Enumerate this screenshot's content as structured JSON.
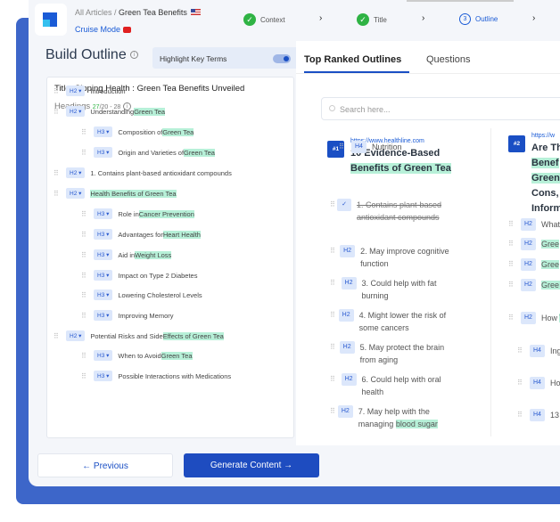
{
  "header": {
    "breadcrumb_root": "All Articles /",
    "breadcrumb_current": "Green Tea Benefits",
    "cruise_mode": "Cruise Mode",
    "steps": [
      {
        "label": "Context",
        "state": "done"
      },
      {
        "label": "Title",
        "state": "done"
      },
      {
        "label": "Outline",
        "state": "current",
        "number": "3"
      }
    ]
  },
  "left": {
    "title": "Build Outline",
    "highlight_label": "Highlight Key Terms",
    "highlight_on": true,
    "article_title": "Title: Sipping Health : Green Tea Benefits Unveiled",
    "headings_label": "Headings",
    "headings_count": "27",
    "headings_range": "/20 - 28",
    "headings": [
      {
        "level": "H2",
        "parts": [
          {
            "t": "Introduction"
          }
        ]
      },
      {
        "level": "H2",
        "parts": [
          {
            "t": "Understanding "
          },
          {
            "t": "Green Tea",
            "hl": true
          }
        ]
      },
      {
        "level": "H3",
        "parts": [
          {
            "t": "Composition of "
          },
          {
            "t": "Green Tea",
            "hl": true
          }
        ]
      },
      {
        "level": "H3",
        "parts": [
          {
            "t": "Origin and Varieties of "
          },
          {
            "t": "Green Tea",
            "hl": true
          }
        ]
      },
      {
        "level": "H2",
        "parts": [
          {
            "t": "1. Contains plant-based antioxidant compounds"
          }
        ]
      },
      {
        "level": "H2",
        "parts": [
          {
            "t": "Health Benefits of Green Tea",
            "hl": true
          }
        ]
      },
      {
        "level": "H3",
        "parts": [
          {
            "t": "Role in "
          },
          {
            "t": "Cancer Prevention",
            "hl": true
          }
        ]
      },
      {
        "level": "H3",
        "parts": [
          {
            "t": "Advantages for "
          },
          {
            "t": "Heart Health",
            "hl": true
          }
        ]
      },
      {
        "level": "H3",
        "parts": [
          {
            "t": "Aid in "
          },
          {
            "t": "Weight Loss",
            "hl": true
          }
        ]
      },
      {
        "level": "H3",
        "parts": [
          {
            "t": "Impact on Type 2 Diabetes"
          }
        ]
      },
      {
        "level": "H3",
        "parts": [
          {
            "t": "Lowering Cholesterol Levels"
          }
        ]
      },
      {
        "level": "H3",
        "parts": [
          {
            "t": "Improving Memory"
          }
        ]
      },
      {
        "level": "H2",
        "parts": [
          {
            "t": "Potential Risks and Side "
          },
          {
            "t": "Effects of Green Tea",
            "hl": true
          }
        ]
      },
      {
        "level": "H3",
        "parts": [
          {
            "t": "When to Avoid "
          },
          {
            "t": "Green Tea",
            "hl": true
          }
        ]
      },
      {
        "level": "H3",
        "parts": [
          {
            "t": "Possible Interactions with Medications"
          }
        ]
      }
    ]
  },
  "right": {
    "tabs": [
      "Top Ranked Outlines",
      "Questions"
    ],
    "search_placeholder": "Search here...",
    "outlines": [
      {
        "rank": "#1",
        "url": "https://www.healthline.com",
        "title_lines": [
          {
            "t": "10 Evidence-Based"
          },
          {
            "t": "Benefits of Green Tea",
            "hl": true
          }
        ],
        "items": [
          {
            "level": "H4",
            "parts": [
              {
                "t": "Nutrition"
              }
            ]
          },
          {
            "level": "check",
            "done": true,
            "parts": [
              {
                "t": "1. Contains plant-based antioxidant compounds"
              }
            ]
          },
          {
            "level": "H2",
            "parts": [
              {
                "t": "2. May improve cognitive function"
              }
            ]
          },
          {
            "level": "H2",
            "parts": [
              {
                "t": "3. Could help with fat burning"
              }
            ]
          },
          {
            "level": "H2",
            "parts": [
              {
                "t": "4. Might lower the risk of some cancers"
              }
            ]
          },
          {
            "level": "H2",
            "parts": [
              {
                "t": "5. May protect the brain from aging"
              }
            ]
          },
          {
            "level": "H2",
            "parts": [
              {
                "t": "6. Could help with oral health"
              }
            ]
          },
          {
            "level": "H2",
            "parts": [
              {
                "t": "7. May help with the managing "
              },
              {
                "t": "blood sugar",
                "hl": true
              }
            ]
          }
        ]
      },
      {
        "rank": "#2",
        "url": "https://w",
        "title_lines": [
          {
            "t": "Are Th"
          },
          {
            "t": "Benef",
            "hl": true
          },
          {
            "t": "Green",
            "hl": true
          },
          {
            "t": "Cons,"
          },
          {
            "t": "Inform"
          }
        ],
        "items": [
          {
            "level": "H2",
            "parts": [
              {
                "t": "What"
              }
            ]
          },
          {
            "level": "H2",
            "parts": [
              {
                "t": "Gree",
                "hl": true
              }
            ]
          },
          {
            "level": "H2",
            "parts": [
              {
                "t": "Gree",
                "hl": true
              }
            ]
          },
          {
            "level": "H2",
            "parts": [
              {
                "t": "Gree Effec",
                "hl": true
              }
            ]
          },
          {
            "level": "H2",
            "parts": [
              {
                "t": "How "
              },
              {
                "t": "Tea",
                "hl": true
              }
            ]
          },
          {
            "level": "H4",
            "parts": [
              {
                "t": "Ing Fa"
              }
            ]
          },
          {
            "level": "H4",
            "parts": [
              {
                "t": "Ho Sa"
              }
            ]
          },
          {
            "level": "H4",
            "parts": [
              {
                "t": "13"
              }
            ]
          }
        ]
      }
    ]
  },
  "footer": {
    "previous": "← Previous",
    "generate": "Generate Content →"
  }
}
